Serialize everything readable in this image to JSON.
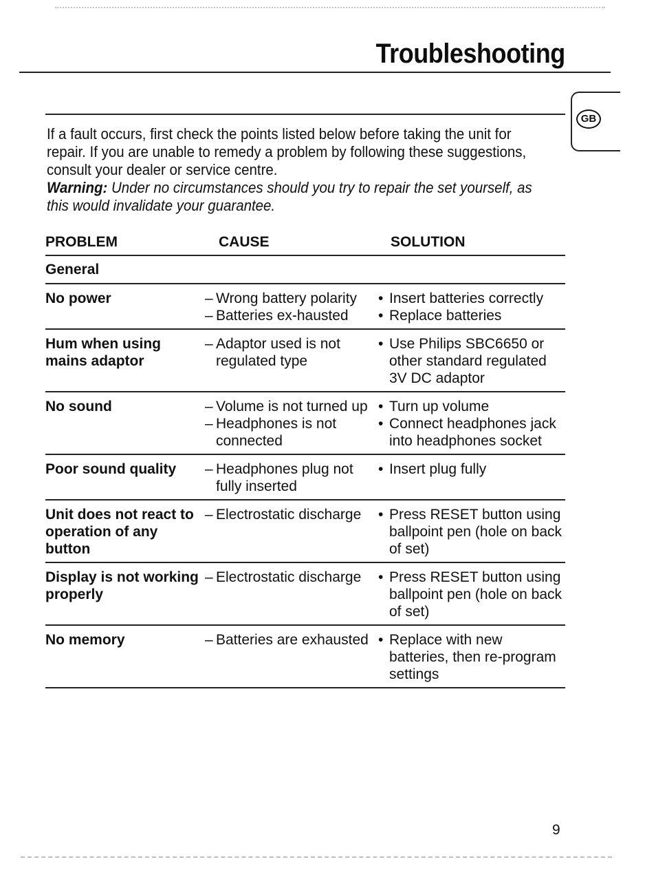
{
  "page": {
    "title": "Troubleshooting",
    "language_badge": "GB",
    "page_number": "9"
  },
  "intro": {
    "paragraph": "If a fault occurs, first check the points listed below before taking the unit for repair. If you are unable to remedy a problem by following these suggestions, consult your dealer or service centre.",
    "warning_label": "Warning:",
    "warning_text": " Under no circumstances should you try to repair the set yourself, as this would invalidate your guarantee."
  },
  "table": {
    "headers": {
      "problem": "PROBLEM",
      "cause": "CAUSE",
      "solution": "SOLUTION"
    },
    "section": "General",
    "rows": [
      {
        "problem": "No power",
        "causes": [
          "Wrong battery polarity",
          "Batteries ex-hausted"
        ],
        "solutions": [
          "Insert batteries correctly",
          "Replace batteries"
        ]
      },
      {
        "problem": "Hum when using mains adaptor",
        "causes": [
          "Adaptor used is not regulated type"
        ],
        "solutions": [
          "Use Philips SBC6650 or other standard regulated 3V DC adaptor"
        ]
      },
      {
        "problem": "No sound",
        "causes": [
          "Volume is not turned up",
          "Headphones is not connected"
        ],
        "solutions": [
          "Turn up volume",
          "Connect headphones jack into headphones socket"
        ]
      },
      {
        "problem": "Poor sound quality",
        "causes": [
          "Headphones plug not fully inserted"
        ],
        "solutions": [
          "Insert plug fully"
        ]
      },
      {
        "problem": "Unit does not react to operation of any button",
        "causes": [
          "Electrostatic discharge"
        ],
        "solutions": [
          "Press RESET button using ballpoint pen (hole on back of set)"
        ]
      },
      {
        "problem": "Display is not working properly",
        "causes": [
          "Electrostatic discharge"
        ],
        "solutions": [
          "Press RESET button using ballpoint pen (hole on back of set)"
        ]
      },
      {
        "problem": "No memory",
        "causes": [
          "Batteries are exhausted"
        ],
        "solutions": [
          "Replace with new batteries, then re-program settings"
        ]
      }
    ],
    "cause_marker": "–",
    "solution_marker": "•"
  }
}
